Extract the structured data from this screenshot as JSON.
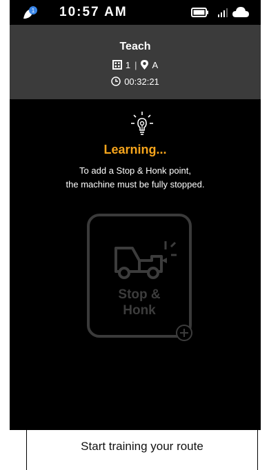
{
  "status_bar": {
    "time": "10:57 AM",
    "notification_count": "1",
    "icons": [
      "notification-bubble-icon",
      "battery-icon",
      "signal-icon",
      "cloud-icon"
    ]
  },
  "header": {
    "title": "Teach",
    "route_number": "1",
    "separator": "|",
    "location": "A",
    "elapsed_time": "00:32:21"
  },
  "learning": {
    "title": "Learning...",
    "instruction_line1": "To add a Stop & Honk point,",
    "instruction_line2": "the machine must be fully stopped."
  },
  "stop_honk": {
    "label_line1": "Stop &",
    "label_line2": "Honk",
    "state": "disabled"
  },
  "footer": {
    "label": "Start training your route"
  },
  "colors": {
    "accent": "#f7a51c",
    "header_bg": "#3b3b3b",
    "screen_bg": "#000000",
    "disabled": "#3c3c3c"
  }
}
